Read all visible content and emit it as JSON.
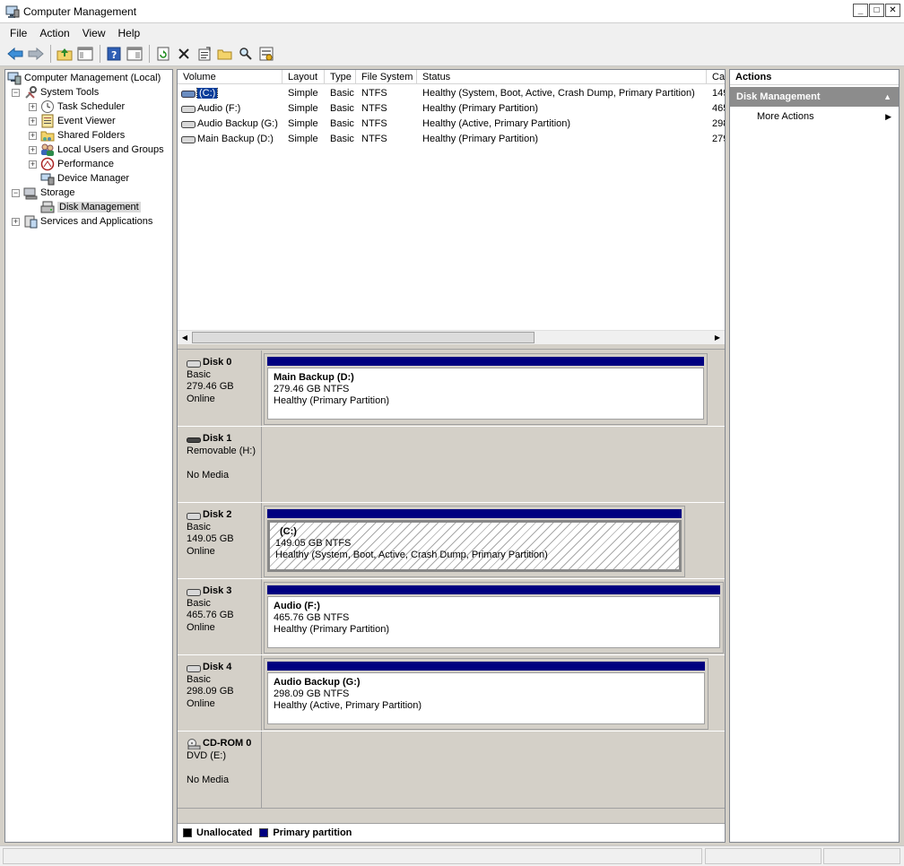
{
  "window": {
    "title": "Computer Management"
  },
  "menu": {
    "file": "File",
    "action": "Action",
    "view": "View",
    "help": "Help"
  },
  "toolbar": {
    "icons": [
      "back-arrow-icon",
      "forward-arrow-icon",
      "up-folder-icon",
      "show-hide-console-tree-icon",
      "help-icon",
      "show-hide-action-pane-icon",
      "refresh-icon",
      "delete-icon",
      "properties-icon",
      "open-folder-icon",
      "search-icon",
      "settings-icon"
    ]
  },
  "tree": {
    "root": "Computer Management (Local)",
    "system_tools": "System Tools",
    "task_scheduler": "Task Scheduler",
    "event_viewer": "Event Viewer",
    "shared_folders": "Shared Folders",
    "local_users": "Local Users and Groups",
    "performance": "Performance",
    "device_manager": "Device Manager",
    "storage": "Storage",
    "disk_management": "Disk Management",
    "services": "Services and Applications"
  },
  "volume_list": {
    "columns": [
      "Volume",
      "Layout",
      "Type",
      "File System",
      "Status",
      "Ca"
    ],
    "rows": [
      {
        "volume": "(C:)",
        "layout": "Simple",
        "type": "Basic",
        "fs": "NTFS",
        "status": "Healthy (System, Boot, Active, Crash Dump, Primary Partition)",
        "cap": "149"
      },
      {
        "volume": "Audio (F:)",
        "layout": "Simple",
        "type": "Basic",
        "fs": "NTFS",
        "status": "Healthy (Primary Partition)",
        "cap": "465"
      },
      {
        "volume": "Audio Backup (G:)",
        "layout": "Simple",
        "type": "Basic",
        "fs": "NTFS",
        "status": "Healthy (Active, Primary Partition)",
        "cap": "298"
      },
      {
        "volume": "Main Backup (D:)",
        "layout": "Simple",
        "type": "Basic",
        "fs": "NTFS",
        "status": "Healthy (Primary Partition)",
        "cap": "279"
      }
    ]
  },
  "disks": [
    {
      "name": "Disk 0",
      "line1": "Basic",
      "line2": "279.46 GB",
      "line3": "Online",
      "part_name": "Main Backup  (D:)",
      "part_size": "279.46 GB NTFS",
      "part_status": "Healthy (Primary Partition)"
    },
    {
      "name": "Disk 1",
      "line1": "Removable (H:)",
      "line2": "",
      "line3": "No Media"
    },
    {
      "name": "Disk 2",
      "line1": "Basic",
      "line2": "149.05 GB",
      "line3": "Online",
      "part_name": "(C:)",
      "part_size": "149.05 GB NTFS",
      "part_status": "Healthy (System, Boot, Active, Crash Dump, Primary Partition)"
    },
    {
      "name": "Disk 3",
      "line1": "Basic",
      "line2": "465.76 GB",
      "line3": "Online",
      "part_name": "Audio  (F:)",
      "part_size": "465.76 GB NTFS",
      "part_status": "Healthy (Primary Partition)"
    },
    {
      "name": "Disk 4",
      "line1": "Basic",
      "line2": "298.09 GB",
      "line3": "Online",
      "part_name": "Audio Backup  (G:)",
      "part_size": "298.09 GB NTFS",
      "part_status": "Healthy (Active, Primary Partition)"
    },
    {
      "name": "CD-ROM 0",
      "line1": "DVD (E:)",
      "line2": "",
      "line3": "No Media"
    }
  ],
  "legend": {
    "unallocated": "Unallocated",
    "primary": "Primary partition",
    "unallocated_color": "#000000",
    "primary_color": "#000080"
  },
  "actions": {
    "title": "Actions",
    "section": "Disk Management",
    "more": "More Actions"
  }
}
